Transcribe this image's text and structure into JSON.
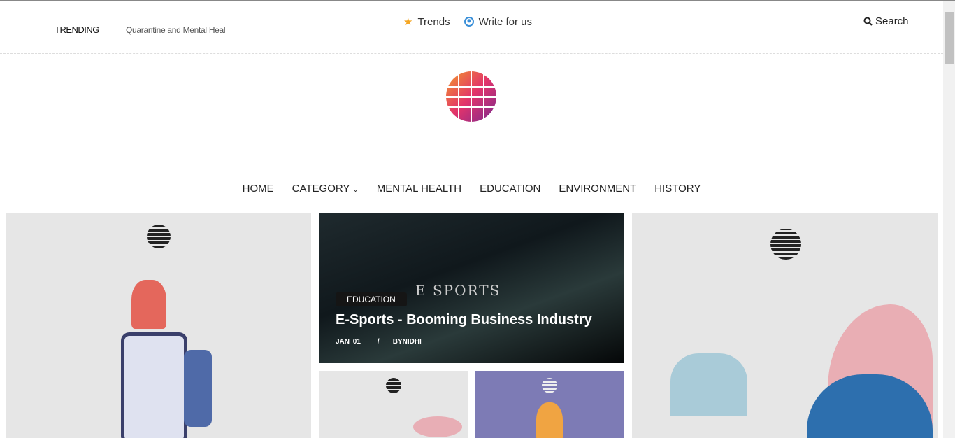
{
  "topbar": {
    "trending_label": "TRENDING",
    "trending_title": "Quarantine and Mental Heal",
    "links": [
      {
        "label": "Trends",
        "icon": "star-icon"
      },
      {
        "label": "Write for us",
        "icon": "user-circle-icon"
      }
    ],
    "search_label": "Search"
  },
  "nav": {
    "items": [
      "HOME",
      "CATEGORY",
      "MENTAL HEALTH",
      "EDUCATION",
      "ENVIRONMENT",
      "HISTORY"
    ]
  },
  "featured": {
    "image_text": "E SPORTS",
    "category": "EDUCATION",
    "title": "E-Sports - Booming Business Industry",
    "date": "JAN 01",
    "separator": "/",
    "author": "BYNIDHI"
  },
  "colors": {
    "star": "#f5a623",
    "user_icon": "#3a8fd8"
  }
}
